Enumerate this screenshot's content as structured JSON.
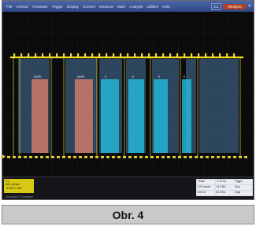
{
  "menu": {
    "items": [
      "File",
      "Vertical",
      "Timebase",
      "Trigger",
      "Display",
      "Cursors",
      "Measure",
      "Math",
      "Analysis",
      "Utilities",
      "Help"
    ],
    "ctrl_label": "C1",
    "brand_label": "Teledyne",
    "window_glyph": "✕"
  },
  "decode": {
    "packet_labels": [
      "0x0Fh",
      "0x0Fh",
      "S",
      "E",
      "S",
      "E"
    ]
  },
  "channel": {
    "line1": "C1",
    "line2": "500 mV/div",
    "line3": "-1.690 V ofst"
  },
  "decode_status": "Decoding C1  Completed",
  "timebase": {
    "cells": [
      "Tbase",
      "-1.47 ms",
      "Trigger",
      "2.00 ms/div",
      "10.0 MS",
      "Stop",
      "500 kS",
      "50 MS/s",
      "Edge"
    ]
  },
  "caption": "Obr. 4",
  "colors": {
    "signal": "#f2de2a",
    "packet_highlight": "#4d76a3",
    "address_field": "#cf7a6a",
    "data_field": "#22b6d6",
    "menu_bg": "#3d5592"
  }
}
